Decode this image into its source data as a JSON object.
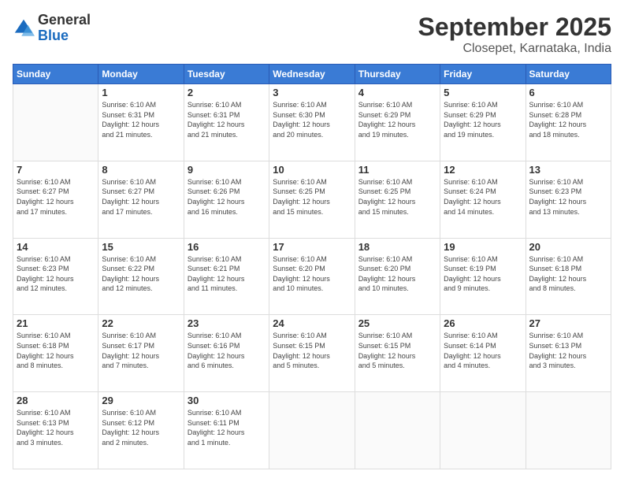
{
  "logo": {
    "general": "General",
    "blue": "Blue"
  },
  "header": {
    "month": "September 2025",
    "location": "Closepet, Karnataka, India"
  },
  "weekdays": [
    "Sunday",
    "Monday",
    "Tuesday",
    "Wednesday",
    "Thursday",
    "Friday",
    "Saturday"
  ],
  "weeks": [
    [
      null,
      {
        "day": 1,
        "sunrise": "6:10 AM",
        "sunset": "6:31 PM",
        "daylight": "12 hours and 21 minutes."
      },
      {
        "day": 2,
        "sunrise": "6:10 AM",
        "sunset": "6:31 PM",
        "daylight": "12 hours and 21 minutes."
      },
      {
        "day": 3,
        "sunrise": "6:10 AM",
        "sunset": "6:30 PM",
        "daylight": "12 hours and 20 minutes."
      },
      {
        "day": 4,
        "sunrise": "6:10 AM",
        "sunset": "6:29 PM",
        "daylight": "12 hours and 19 minutes."
      },
      {
        "day": 5,
        "sunrise": "6:10 AM",
        "sunset": "6:29 PM",
        "daylight": "12 hours and 19 minutes."
      },
      {
        "day": 6,
        "sunrise": "6:10 AM",
        "sunset": "6:28 PM",
        "daylight": "12 hours and 18 minutes."
      }
    ],
    [
      {
        "day": 7,
        "sunrise": "6:10 AM",
        "sunset": "6:27 PM",
        "daylight": "12 hours and 17 minutes."
      },
      {
        "day": 8,
        "sunrise": "6:10 AM",
        "sunset": "6:27 PM",
        "daylight": "12 hours and 17 minutes."
      },
      {
        "day": 9,
        "sunrise": "6:10 AM",
        "sunset": "6:26 PM",
        "daylight": "12 hours and 16 minutes."
      },
      {
        "day": 10,
        "sunrise": "6:10 AM",
        "sunset": "6:25 PM",
        "daylight": "12 hours and 15 minutes."
      },
      {
        "day": 11,
        "sunrise": "6:10 AM",
        "sunset": "6:25 PM",
        "daylight": "12 hours and 15 minutes."
      },
      {
        "day": 12,
        "sunrise": "6:10 AM",
        "sunset": "6:24 PM",
        "daylight": "12 hours and 14 minutes."
      },
      {
        "day": 13,
        "sunrise": "6:10 AM",
        "sunset": "6:23 PM",
        "daylight": "12 hours and 13 minutes."
      }
    ],
    [
      {
        "day": 14,
        "sunrise": "6:10 AM",
        "sunset": "6:23 PM",
        "daylight": "12 hours and 12 minutes."
      },
      {
        "day": 15,
        "sunrise": "6:10 AM",
        "sunset": "6:22 PM",
        "daylight": "12 hours and 12 minutes."
      },
      {
        "day": 16,
        "sunrise": "6:10 AM",
        "sunset": "6:21 PM",
        "daylight": "12 hours and 11 minutes."
      },
      {
        "day": 17,
        "sunrise": "6:10 AM",
        "sunset": "6:20 PM",
        "daylight": "12 hours and 10 minutes."
      },
      {
        "day": 18,
        "sunrise": "6:10 AM",
        "sunset": "6:20 PM",
        "daylight": "12 hours and 10 minutes."
      },
      {
        "day": 19,
        "sunrise": "6:10 AM",
        "sunset": "6:19 PM",
        "daylight": "12 hours and 9 minutes."
      },
      {
        "day": 20,
        "sunrise": "6:10 AM",
        "sunset": "6:18 PM",
        "daylight": "12 hours and 8 minutes."
      }
    ],
    [
      {
        "day": 21,
        "sunrise": "6:10 AM",
        "sunset": "6:18 PM",
        "daylight": "12 hours and 8 minutes."
      },
      {
        "day": 22,
        "sunrise": "6:10 AM",
        "sunset": "6:17 PM",
        "daylight": "12 hours and 7 minutes."
      },
      {
        "day": 23,
        "sunrise": "6:10 AM",
        "sunset": "6:16 PM",
        "daylight": "12 hours and 6 minutes."
      },
      {
        "day": 24,
        "sunrise": "6:10 AM",
        "sunset": "6:15 PM",
        "daylight": "12 hours and 5 minutes."
      },
      {
        "day": 25,
        "sunrise": "6:10 AM",
        "sunset": "6:15 PM",
        "daylight": "12 hours and 5 minutes."
      },
      {
        "day": 26,
        "sunrise": "6:10 AM",
        "sunset": "6:14 PM",
        "daylight": "12 hours and 4 minutes."
      },
      {
        "day": 27,
        "sunrise": "6:10 AM",
        "sunset": "6:13 PM",
        "daylight": "12 hours and 3 minutes."
      }
    ],
    [
      {
        "day": 28,
        "sunrise": "6:10 AM",
        "sunset": "6:13 PM",
        "daylight": "12 hours and 3 minutes."
      },
      {
        "day": 29,
        "sunrise": "6:10 AM",
        "sunset": "6:12 PM",
        "daylight": "12 hours and 2 minutes."
      },
      {
        "day": 30,
        "sunrise": "6:10 AM",
        "sunset": "6:11 PM",
        "daylight": "12 hours and 1 minute."
      },
      null,
      null,
      null,
      null
    ]
  ]
}
